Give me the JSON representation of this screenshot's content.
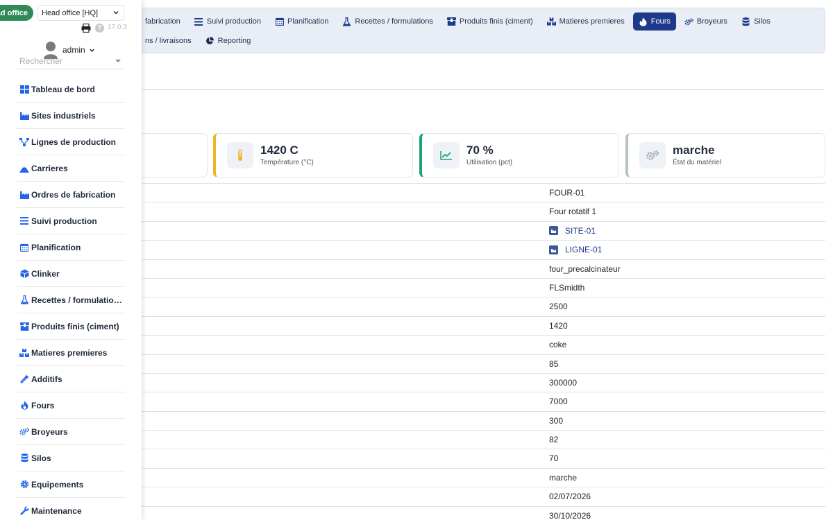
{
  "drawer": {
    "company_badge": "ad office",
    "company_select": "Head office [HQ]",
    "version": "17.0.3",
    "help": "?",
    "user": "admin",
    "search_placeholder": "Rechercher",
    "menu": [
      {
        "label": "Tableau de bord",
        "icon": "dashboard-icon"
      },
      {
        "label": "Sites industriels",
        "icon": "factory-icon"
      },
      {
        "label": "Lignes de production",
        "icon": "sitemap-icon"
      },
      {
        "label": "Carrieres",
        "icon": "mountain-icon"
      },
      {
        "label": "Ordres de fabrication",
        "icon": "factory-icon"
      },
      {
        "label": "Suivi production",
        "icon": "list-icon"
      },
      {
        "label": "Planification",
        "icon": "calendar-icon"
      },
      {
        "label": "Clinker",
        "icon": "cube-icon"
      },
      {
        "label": "Recettes / formulatio…",
        "icon": "flask-icon"
      },
      {
        "label": "Produits finis (ciment)",
        "icon": "box-icon"
      },
      {
        "label": "Matieres premieres",
        "icon": "boxes-icon"
      },
      {
        "label": "Additifs",
        "icon": "eyedropper-icon"
      },
      {
        "label": "Fours",
        "icon": "fire-icon"
      },
      {
        "label": "Broyeurs",
        "icon": "gears-icon"
      },
      {
        "label": "Silos",
        "icon": "database-icon"
      },
      {
        "label": "Equipements",
        "icon": "cog-icon"
      },
      {
        "label": "Maintenance",
        "icon": "wrench-icon"
      }
    ]
  },
  "topnav": {
    "row1": [
      {
        "label": "fabrication",
        "icon": ""
      },
      {
        "label": "Suivi production",
        "icon": "list-icon"
      },
      {
        "label": "Planification",
        "icon": "calendar-icon"
      },
      {
        "label": "Recettes / formulations",
        "icon": "flask-icon"
      },
      {
        "label": "Produits finis (ciment)",
        "icon": "box-icon"
      },
      {
        "label": "Matieres premieres",
        "icon": "boxes-icon"
      },
      {
        "label": "Fours",
        "icon": "fire-icon",
        "active": true
      },
      {
        "label": "Broyeurs",
        "icon": "gears-icon"
      },
      {
        "label": "Silos",
        "icon": "database-icon"
      }
    ],
    "row2": [
      {
        "label": "ns / livraisons",
        "icon": ""
      },
      {
        "label": "Reporting",
        "icon": "chart-pie-icon"
      }
    ]
  },
  "kpis": [
    {
      "value": "1420 C",
      "label": "Température (°C)",
      "icon": "thermometer-icon",
      "color": "#f0b429"
    },
    {
      "value": "70 %",
      "label": "Utilisation (pct)",
      "icon": "chart-line-icon",
      "color": "#1aa37a"
    },
    {
      "value": "marche",
      "label": "État du matériel",
      "icon": "gears-icon",
      "color": "#b8c0c8"
    }
  ],
  "details": [
    {
      "value": "FOUR-01"
    },
    {
      "value": "Four rotatif 1"
    },
    {
      "value": "SITE-01",
      "link": true
    },
    {
      "value": "LIGNE-01",
      "link": true
    },
    {
      "value": "four_precalcinateur"
    },
    {
      "value": "FLSmidth"
    },
    {
      "value": "2500"
    },
    {
      "value": "1420"
    },
    {
      "value": "coke"
    },
    {
      "value": "85"
    },
    {
      "value": "300000"
    },
    {
      "value": "7000"
    },
    {
      "value": "300"
    },
    {
      "value": "82"
    },
    {
      "value": "70"
    },
    {
      "value": "marche"
    },
    {
      "value": "02/07/2026"
    },
    {
      "value": "30/10/2026"
    }
  ],
  "colors": {
    "accent": "#1e3a8a",
    "badge": "#2e8b57",
    "icon_blue": "#2563eb"
  }
}
